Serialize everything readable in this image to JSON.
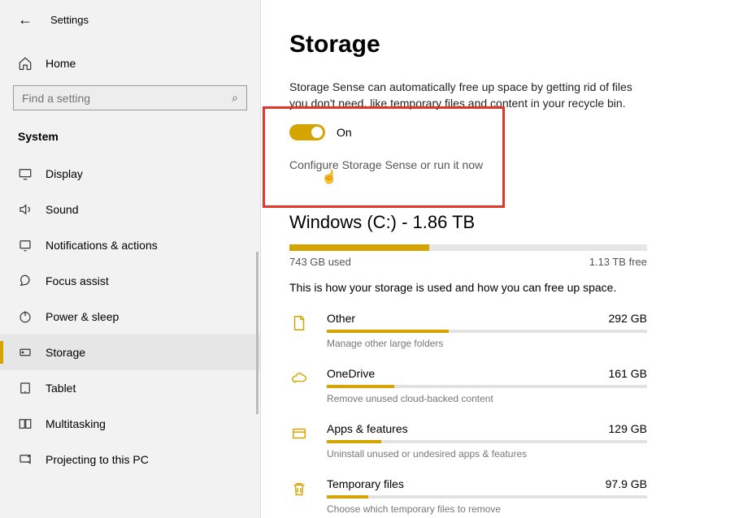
{
  "header": {
    "title": "Settings"
  },
  "sidebar": {
    "home": "Home",
    "search_placeholder": "Find a setting",
    "section": "System",
    "items": [
      {
        "label": "Display",
        "icon": "display-icon"
      },
      {
        "label": "Sound",
        "icon": "sound-icon"
      },
      {
        "label": "Notifications & actions",
        "icon": "notifications-icon"
      },
      {
        "label": "Focus assist",
        "icon": "focus-assist-icon"
      },
      {
        "label": "Power & sleep",
        "icon": "power-icon"
      },
      {
        "label": "Storage",
        "icon": "storage-icon"
      },
      {
        "label": "Tablet",
        "icon": "tablet-icon"
      },
      {
        "label": "Multitasking",
        "icon": "multitasking-icon"
      },
      {
        "label": "Projecting to this PC",
        "icon": "projecting-icon"
      }
    ]
  },
  "main": {
    "title": "Storage",
    "sense_desc": "Storage Sense can automatically free up space by getting rid of files you don't need, like temporary files and content in your recycle bin.",
    "toggle_state": "On",
    "configure_link": "Configure Storage Sense or run it now",
    "drive": {
      "title": "Windows (C:) - 1.86 TB",
      "used": "743 GB used",
      "free": "1.13 TB free",
      "fill_pct": 39
    },
    "usage_desc": "This is how your storage is used and how you can free up space.",
    "usage": [
      {
        "name": "Other",
        "size": "292 GB",
        "sub": "Manage other large folders",
        "pct": 38
      },
      {
        "name": "OneDrive",
        "size": "161 GB",
        "sub": "Remove unused cloud-backed content",
        "pct": 21
      },
      {
        "name": "Apps & features",
        "size": "129 GB",
        "sub": "Uninstall unused or undesired apps & features",
        "pct": 17
      },
      {
        "name": "Temporary files",
        "size": "97.9 GB",
        "sub": "Choose which temporary files to remove",
        "pct": 13
      }
    ]
  },
  "colors": {
    "accent": "#d5a400",
    "highlight": "#e2362b"
  }
}
